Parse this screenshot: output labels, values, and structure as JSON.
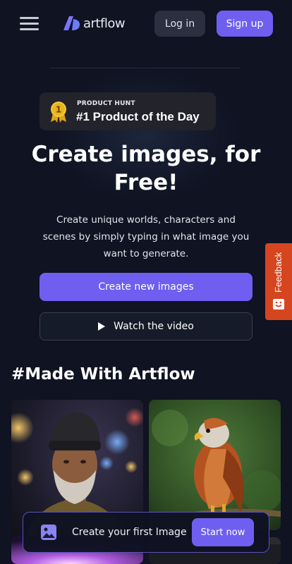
{
  "header": {
    "logo_text": "artflow",
    "login_label": "Log in",
    "signup_label": "Sign up"
  },
  "badge": {
    "label_small": "PRODUCT HUNT",
    "label_big": "#1 Product of the Day",
    "medal_number": "1"
  },
  "hero": {
    "title": "Create images, for Free!",
    "subtitle": "Create unique worlds, characters and scenes by simply typing in what image you want to generate.",
    "create_button": "Create new images",
    "video_button": "Watch the video"
  },
  "feedback": {
    "label": "Feedback"
  },
  "gallery": {
    "title": "#Made With Artflow"
  },
  "cta": {
    "text": "Create your first Image",
    "button": "Start now"
  },
  "colors": {
    "background": "#0f1322",
    "accent": "#6f5ff0",
    "feedback": "#d5451f"
  }
}
